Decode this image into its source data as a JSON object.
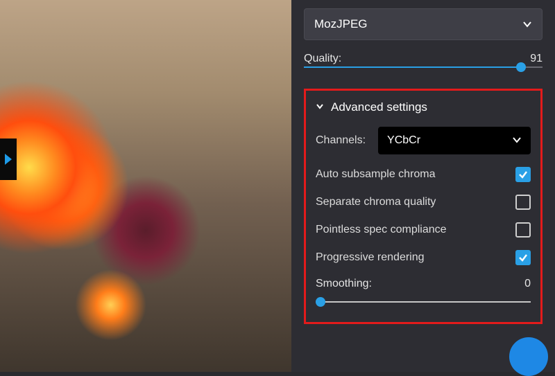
{
  "colors": {
    "accent": "#2aa0e6",
    "highlight": "#e31b1b"
  },
  "encoder": {
    "selected": "MozJPEG"
  },
  "quality": {
    "label": "Quality:",
    "value": "91",
    "percent": 91
  },
  "advanced": {
    "title": "Advanced settings",
    "channels": {
      "label": "Channels:",
      "selected": "YCbCr"
    },
    "options": {
      "auto_subsample": {
        "label": "Auto subsample chroma",
        "checked": true
      },
      "separate_chroma": {
        "label": "Separate chroma quality",
        "checked": false
      },
      "pointless_spec": {
        "label": "Pointless spec compliance",
        "checked": false
      },
      "progressive": {
        "label": "Progressive rendering",
        "checked": true
      }
    },
    "smoothing": {
      "label": "Smoothing:",
      "value": "0",
      "percent": 0
    }
  }
}
